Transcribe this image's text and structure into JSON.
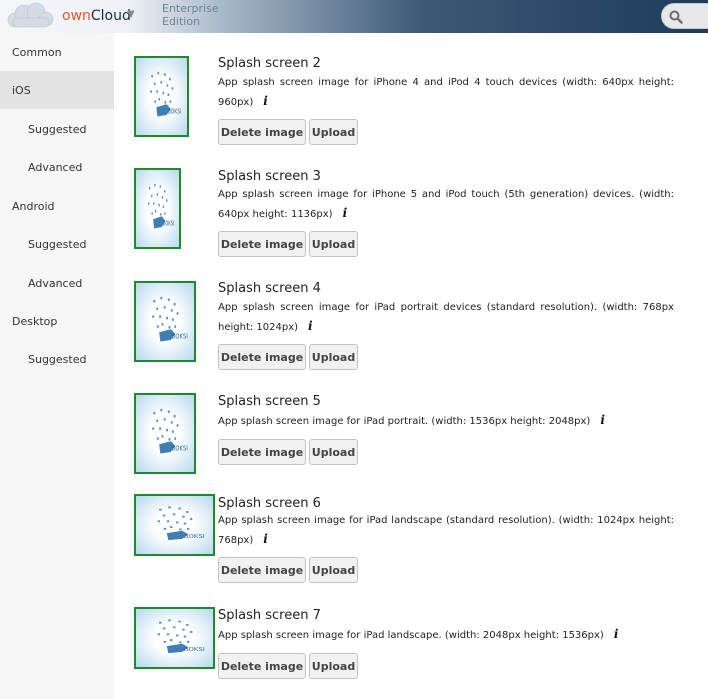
{
  "header": {
    "brand_own": "own",
    "brand_cloud": "Cloud",
    "brand_caret": "▼",
    "edition_line1": "Enterprise",
    "edition_line2": "Edition",
    "search_icon": "search-icon"
  },
  "sidebar": {
    "items": [
      {
        "label": "Common"
      },
      {
        "label": "iOS"
      },
      {
        "label": "Suggested"
      },
      {
        "label": "Advanced"
      },
      {
        "label": "Android"
      },
      {
        "label": "Suggested"
      },
      {
        "label": "Advanced"
      },
      {
        "label": "Desktop"
      },
      {
        "label": "Suggested"
      }
    ]
  },
  "main": {
    "delete_label": "Delete image",
    "upload_label": "Upload",
    "info_glyph": "i",
    "screens": [
      {
        "title": "Splash screen 2",
        "description": "App splash screen image for iPhone 4 and iPod 4 touch devices (width: 640px height: 960px)"
      },
      {
        "title": "Splash screen 3",
        "description": "App splash screen image for iPhone 5 and iPod touch (5th generation) devices. (width: 640px height: 1136px)"
      },
      {
        "title": "Splash screen 4",
        "description": "App splash screen image for iPad portrait devices (standard resolution). (width: 768px height: 1024px)"
      },
      {
        "title": "Splash screen 5",
        "description": "App splash screen image for iPad portrait. (width: 1536px height: 2048px)"
      },
      {
        "title": "Splash screen 6",
        "description": "App splash screen image for iPad landscape (standard resolution). (width: 1024px height: 768px)"
      },
      {
        "title": "Splash screen 7",
        "description": "App splash screen image for iPad landscape. (width: 2048px height: 1536px)"
      }
    ],
    "thumb_text": "BOKSI"
  }
}
